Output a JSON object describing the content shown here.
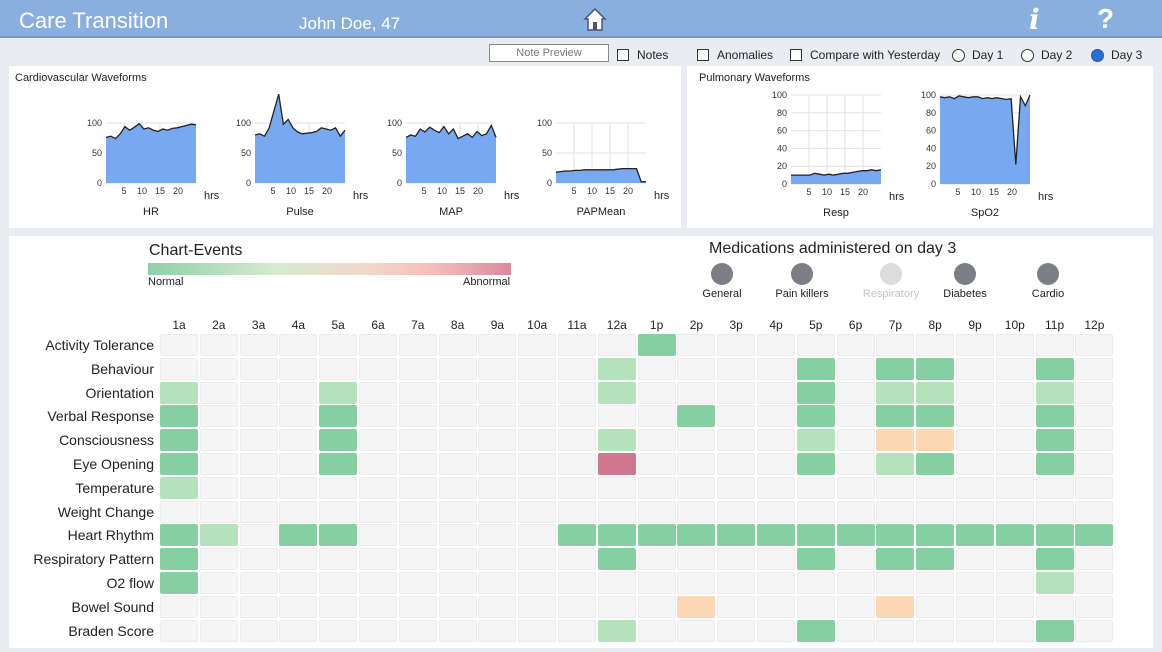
{
  "header": {
    "app_title": "Care Transition",
    "patient": "John Doe, 47",
    "info_label": "i",
    "help_label": "?"
  },
  "controls": {
    "note_preview": "Note Preview",
    "notes": "Notes",
    "anomalies": "Anomalies",
    "compare": "Compare with Yesterday",
    "days": [
      "Day 1",
      "Day 2",
      "Day 3"
    ],
    "selected_day": "Day 3"
  },
  "cardio": {
    "title": "Cardiovascular Waveforms",
    "charts": [
      {
        "label": "HR",
        "yticks": [
          "100",
          "50",
          "0"
        ],
        "xticks": [
          "5",
          "10",
          "15",
          "20"
        ],
        "unit": "hrs",
        "values": [
          76,
          78,
          74,
          82,
          94,
          88,
          93,
          99,
          90,
          92,
          88,
          86,
          90,
          88,
          91,
          92,
          94,
          96,
          98,
          97
        ]
      },
      {
        "label": "Pulse",
        "yticks": [
          "100",
          "50",
          "0"
        ],
        "xticks": [
          "5",
          "10",
          "15",
          "20"
        ],
        "unit": "hrs",
        "values": [
          80,
          82,
          78,
          92,
          120,
          148,
          98,
          106,
          92,
          85,
          82,
          83,
          84,
          86,
          92,
          90,
          88,
          92,
          78,
          88
        ]
      },
      {
        "label": "MAP",
        "yticks": [
          "100",
          "50",
          "0"
        ],
        "xticks": [
          "5",
          "10",
          "15",
          "20"
        ],
        "unit": "hrs",
        "values": [
          76,
          80,
          78,
          90,
          85,
          93,
          88,
          84,
          94,
          82,
          90,
          74,
          78,
          82,
          76,
          86,
          79,
          82,
          96,
          76
        ]
      },
      {
        "label": "PAPMean",
        "yticks": [
          "100",
          "50",
          "0"
        ],
        "xticks": [
          "5",
          "10",
          "15",
          "20"
        ],
        "unit": "hrs",
        "values": [
          18,
          19,
          20,
          20,
          21,
          21,
          22,
          22,
          22,
          22,
          22,
          22,
          22,
          23,
          24,
          24,
          24,
          24,
          2,
          2
        ]
      }
    ]
  },
  "pulmonary": {
    "title": "Pulmonary Waveforms",
    "charts": [
      {
        "label": "Resp",
        "yticks": [
          "100",
          "80",
          "60",
          "40",
          "20",
          "0"
        ],
        "xticks": [
          "5",
          "10",
          "15",
          "20"
        ],
        "unit": "hrs",
        "values": [
          10,
          10,
          10,
          10,
          10,
          12,
          11,
          10,
          11,
          10,
          11,
          12,
          12,
          13,
          14,
          15,
          15,
          16,
          15,
          16
        ]
      },
      {
        "label": "SpO2",
        "yticks": [
          "100",
          "80",
          "60",
          "40",
          "20",
          "0"
        ],
        "xticks": [
          "5",
          "10",
          "15",
          "20"
        ],
        "unit": "hrs",
        "values": [
          98,
          97,
          98,
          96,
          99,
          98,
          97,
          98,
          98,
          96,
          97,
          96,
          97,
          96,
          95,
          96,
          22,
          98,
          88,
          100
        ]
      }
    ]
  },
  "chart_events": {
    "title": "Chart-Events",
    "normal_label": "Normal",
    "abnormal_label": "Abnormal",
    "hours": [
      "1a",
      "2a",
      "3a",
      "4a",
      "5a",
      "6a",
      "7a",
      "8a",
      "9a",
      "10a",
      "11a",
      "12a",
      "1p",
      "2p",
      "3p",
      "4p",
      "5p",
      "6p",
      "7p",
      "8p",
      "9p",
      "10p",
      "11p",
      "12p"
    ],
    "rows": [
      {
        "label": "Activity Tolerance",
        "levels": [
          0,
          0,
          0,
          0,
          0,
          0,
          0,
          0,
          0,
          0,
          0,
          0,
          2,
          0,
          0,
          0,
          0,
          0,
          0,
          0,
          0,
          0,
          0,
          0
        ]
      },
      {
        "label": "Behaviour",
        "levels": [
          0,
          0,
          0,
          0,
          0,
          0,
          0,
          0,
          0,
          0,
          0,
          1,
          0,
          0,
          0,
          0,
          2,
          0,
          2,
          2,
          0,
          0,
          2,
          0
        ]
      },
      {
        "label": "Orientation",
        "levels": [
          1,
          0,
          0,
          0,
          1,
          0,
          0,
          0,
          0,
          0,
          0,
          1,
          0,
          0,
          0,
          0,
          2,
          0,
          1,
          1,
          0,
          0,
          1,
          0
        ]
      },
      {
        "label": "Verbal Response",
        "levels": [
          2,
          0,
          0,
          0,
          2,
          0,
          0,
          0,
          0,
          0,
          0,
          0,
          0,
          2,
          0,
          0,
          2,
          0,
          2,
          2,
          0,
          0,
          2,
          0
        ]
      },
      {
        "label": "Consciousness",
        "levels": [
          2,
          0,
          0,
          0,
          2,
          0,
          0,
          0,
          0,
          0,
          0,
          1,
          0,
          0,
          0,
          0,
          1,
          0,
          3,
          3,
          0,
          0,
          2,
          0
        ]
      },
      {
        "label": "Eye Opening",
        "levels": [
          2,
          0,
          0,
          0,
          2,
          0,
          0,
          0,
          0,
          0,
          0,
          4,
          0,
          0,
          0,
          0,
          2,
          0,
          1,
          2,
          0,
          0,
          2,
          0
        ]
      },
      {
        "label": "Temperature",
        "levels": [
          1,
          0,
          0,
          0,
          0,
          0,
          0,
          0,
          0,
          0,
          0,
          0,
          0,
          0,
          0,
          0,
          0,
          0,
          0,
          0,
          0,
          0,
          0,
          0
        ]
      },
      {
        "label": "Weight Change",
        "levels": [
          0,
          0,
          0,
          0,
          0,
          0,
          0,
          0,
          0,
          0,
          0,
          0,
          0,
          0,
          0,
          0,
          0,
          0,
          0,
          0,
          0,
          0,
          0,
          0
        ]
      },
      {
        "label": "Heart Rhythm",
        "levels": [
          2,
          1,
          0,
          2,
          2,
          0,
          0,
          0,
          0,
          0,
          2,
          2,
          2,
          2,
          2,
          2,
          2,
          2,
          2,
          2,
          2,
          2,
          2,
          2
        ]
      },
      {
        "label": "Respiratory Pattern",
        "levels": [
          2,
          0,
          0,
          0,
          0,
          0,
          0,
          0,
          0,
          0,
          0,
          2,
          0,
          0,
          0,
          0,
          2,
          0,
          2,
          2,
          0,
          0,
          2,
          0
        ]
      },
      {
        "label": "O2 flow",
        "levels": [
          2,
          0,
          0,
          0,
          0,
          0,
          0,
          0,
          0,
          0,
          0,
          0,
          0,
          0,
          0,
          0,
          0,
          0,
          0,
          0,
          0,
          0,
          1,
          0
        ]
      },
      {
        "label": "Bowel Sound",
        "levels": [
          0,
          0,
          0,
          0,
          0,
          0,
          0,
          0,
          0,
          0,
          0,
          0,
          0,
          3,
          0,
          0,
          0,
          0,
          3,
          0,
          0,
          0,
          0,
          0
        ]
      },
      {
        "label": "Braden Score",
        "levels": [
          0,
          0,
          0,
          0,
          0,
          0,
          0,
          0,
          0,
          0,
          0,
          1,
          0,
          0,
          0,
          0,
          2,
          0,
          0,
          0,
          0,
          0,
          2,
          0
        ]
      }
    ]
  },
  "medications": {
    "title": "Medications administered on day 3",
    "items": [
      {
        "label": "General",
        "icon": "pills-icon",
        "enabled": true
      },
      {
        "label": "Pain killers",
        "icon": "pain-icon",
        "enabled": true
      },
      {
        "label": "Respiratory",
        "icon": "lungs-icon",
        "enabled": false
      },
      {
        "label": "Diabetes",
        "icon": "glucose-meter-icon",
        "enabled": true
      },
      {
        "label": "Cardio",
        "icon": "heart-icon",
        "enabled": true
      }
    ]
  },
  "colors": {
    "header": "#8aaedd",
    "chart_fill": "#78a8f0",
    "level_1": "#b5e2bd",
    "level_2": "#86cfa2",
    "level_3": "#fbd7b4",
    "level_4": "#cf778e"
  }
}
